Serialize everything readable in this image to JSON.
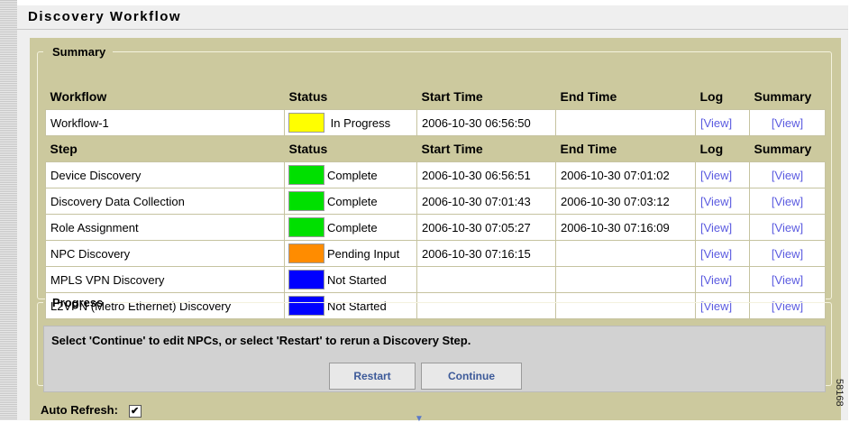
{
  "title": "Discovery Workflow",
  "summary": {
    "legend": "Summary",
    "workflow_headers": [
      "Workflow",
      "Status",
      "Start Time",
      "End Time",
      "Log",
      "Summary"
    ],
    "workflow_row": {
      "name": "Workflow-1",
      "status": "In Progress",
      "status_color": "#ffff00",
      "start": "2006-10-30 06:56:50",
      "end": "",
      "log": "[View]",
      "summary": "[View]"
    },
    "step_headers": [
      "Step",
      "Status",
      "Start Time",
      "End Time",
      "Log",
      "Summary"
    ],
    "steps": [
      {
        "name": "Device Discovery",
        "status": "Complete",
        "status_color": "#00e000",
        "start": "2006-10-30 06:56:51",
        "end": "2006-10-30 07:01:02",
        "log": "[View]",
        "summary": "[View]"
      },
      {
        "name": "Discovery Data Collection",
        "status": "Complete",
        "status_color": "#00e000",
        "start": "2006-10-30 07:01:43",
        "end": "2006-10-30 07:03:12",
        "log": "[View]",
        "summary": "[View]"
      },
      {
        "name": "Role Assignment",
        "status": "Complete",
        "status_color": "#00e000",
        "start": "2006-10-30 07:05:27",
        "end": "2006-10-30 07:16:09",
        "log": "[View]",
        "summary": "[View]"
      },
      {
        "name": "NPC Discovery",
        "status": "Pending Input",
        "status_color": "#ff8c00",
        "start": "2006-10-30 07:16:15",
        "end": "",
        "log": "[View]",
        "summary": "[View]"
      },
      {
        "name": "MPLS VPN Discovery",
        "status": "Not Started",
        "status_color": "#0000ff",
        "start": "",
        "end": "",
        "log": "[View]",
        "summary": "[View]"
      },
      {
        "name": "L2VPN (Metro Ethernet) Discovery",
        "status": "Not Started",
        "status_color": "#0000ff",
        "start": "",
        "end": "",
        "log": "[View]",
        "summary": "[View]"
      }
    ]
  },
  "progress": {
    "legend": "Progress",
    "message": "Select 'Continue' to edit NPCs, or select 'Restart' to rerun a Discovery Step.",
    "restart_label": "Restart",
    "continue_label": "Continue"
  },
  "auto_refresh": {
    "label": "Auto Refresh:",
    "checked": true,
    "check_glyph": "✔"
  },
  "figure_id": "58168"
}
